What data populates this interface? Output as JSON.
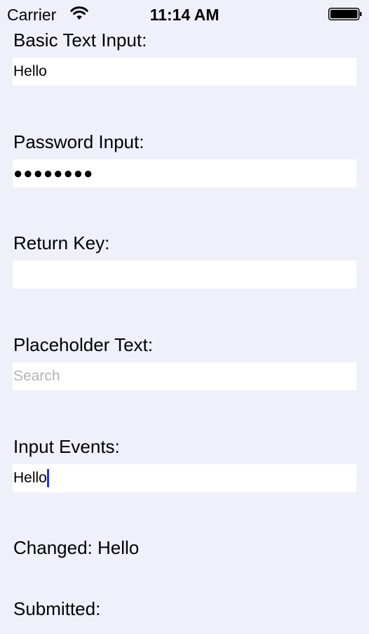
{
  "status_bar": {
    "carrier": "Carrier",
    "time": "11:14 AM"
  },
  "form": {
    "basic": {
      "label": "Basic Text Input:",
      "value": "Hello"
    },
    "password": {
      "label": "Password Input:",
      "masked_value": "●●●●●●●●"
    },
    "return_key": {
      "label": "Return Key:",
      "value": ""
    },
    "placeholder": {
      "label": "Placeholder Text:",
      "placeholder": "Search"
    },
    "events": {
      "label": "Input Events:",
      "value": "Hello"
    },
    "changed": {
      "label": "Changed:",
      "value": "Hello"
    },
    "submitted": {
      "label": "Submitted:",
      "value": ""
    }
  },
  "colors": {
    "background": "#f0f0fb",
    "input_background": "#ffffff",
    "caret": "#1c34e6",
    "placeholder": "#b4b4b8"
  }
}
